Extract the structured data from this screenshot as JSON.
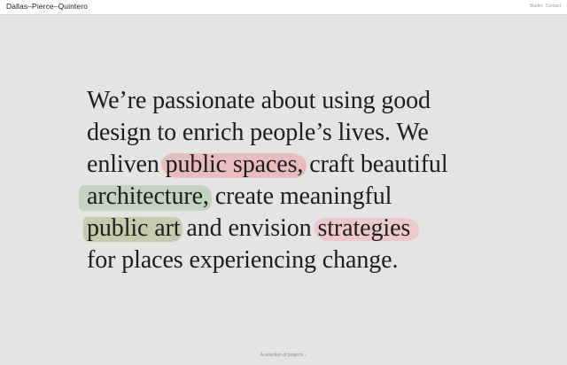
{
  "header": {
    "logo": "Dallas–Pierce–Quintero",
    "nav": [
      {
        "label": "Studio,"
      },
      {
        "label": "Contact"
      }
    ]
  },
  "hero": {
    "line1": "We’re passionate about using good",
    "line2": "design to enrich people’s lives. We",
    "line3_pre": "enliven ",
    "line3_hl": "public spaces,",
    "line3_post": " craft beautiful",
    "line4_hl": "architecture,",
    "line4_post": " create meaningful",
    "line5_hl": "public art",
    "line5_mid": " and envision ",
    "line5_hl2": "strategies",
    "line6": "for places experiencing change."
  },
  "highlight_colors": {
    "public_spaces": "#e8b0b0",
    "architecture": "#b4ccb4",
    "public_art": "#bec4a0",
    "strategies": "#f0c4c8"
  },
  "footer": {
    "link": "A selection of projects ↓"
  },
  "colors": {
    "background": "#e4e4e4",
    "header_bg": "#ffffff",
    "text": "#1d1d1d"
  }
}
